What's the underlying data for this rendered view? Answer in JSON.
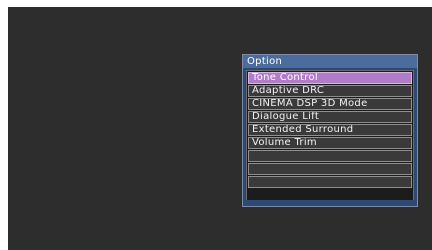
{
  "option_menu": {
    "title": "Option",
    "items": [
      {
        "label": "Tone Control",
        "selected": true
      },
      {
        "label": "Adaptive DRC",
        "selected": false
      },
      {
        "label": "CINEMA DSP 3D Mode",
        "selected": false
      },
      {
        "label": "Dialogue Lift",
        "selected": false
      },
      {
        "label": "Extended Surround",
        "selected": false
      },
      {
        "label": "Volume Trim",
        "selected": false
      },
      {
        "label": "",
        "selected": false
      },
      {
        "label": "",
        "selected": false
      },
      {
        "label": "",
        "selected": false
      }
    ]
  },
  "colors": {
    "screen_background": "#2d2d2d",
    "panel_background": "#2f4a72",
    "panel_title_background": "#4b6c9c",
    "selected_item": "#b07bc7",
    "item_background": "#3a3a3a"
  }
}
